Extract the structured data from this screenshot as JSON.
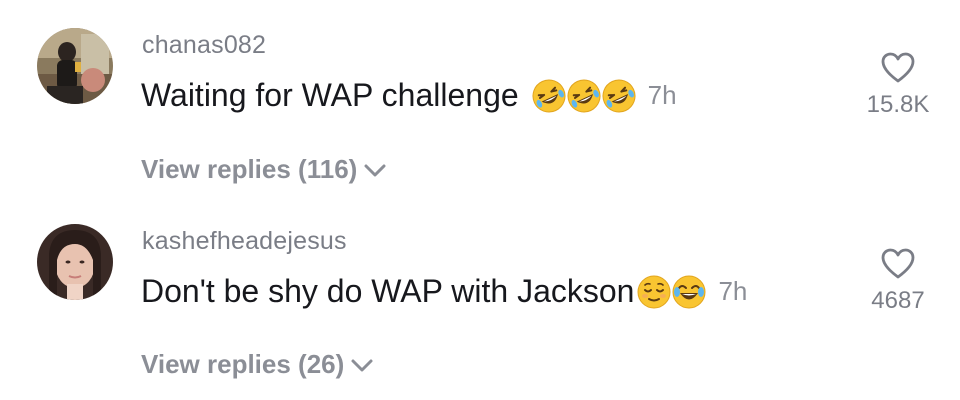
{
  "comments": [
    {
      "username": "chanas082",
      "text": "Waiting for WAP challenge",
      "emojis": [
        "rofl-emoji",
        "rofl-emoji",
        "rofl-emoji"
      ],
      "time": "7h",
      "view_replies": "View replies (116)",
      "likes": "15.8K"
    },
    {
      "username": "kashefheadejesus",
      "text": "Don't be shy do WAP with Jackson",
      "emojis": [
        "relieved-emoji",
        "tears-of-joy-emoji"
      ],
      "time": "7h",
      "view_replies": "View replies (26)",
      "likes": "4687"
    }
  ],
  "colors": {
    "username": "#7a7d86",
    "text": "#17181d",
    "secondary": "#8b8e96",
    "emoji_face": "#f9c531"
  }
}
